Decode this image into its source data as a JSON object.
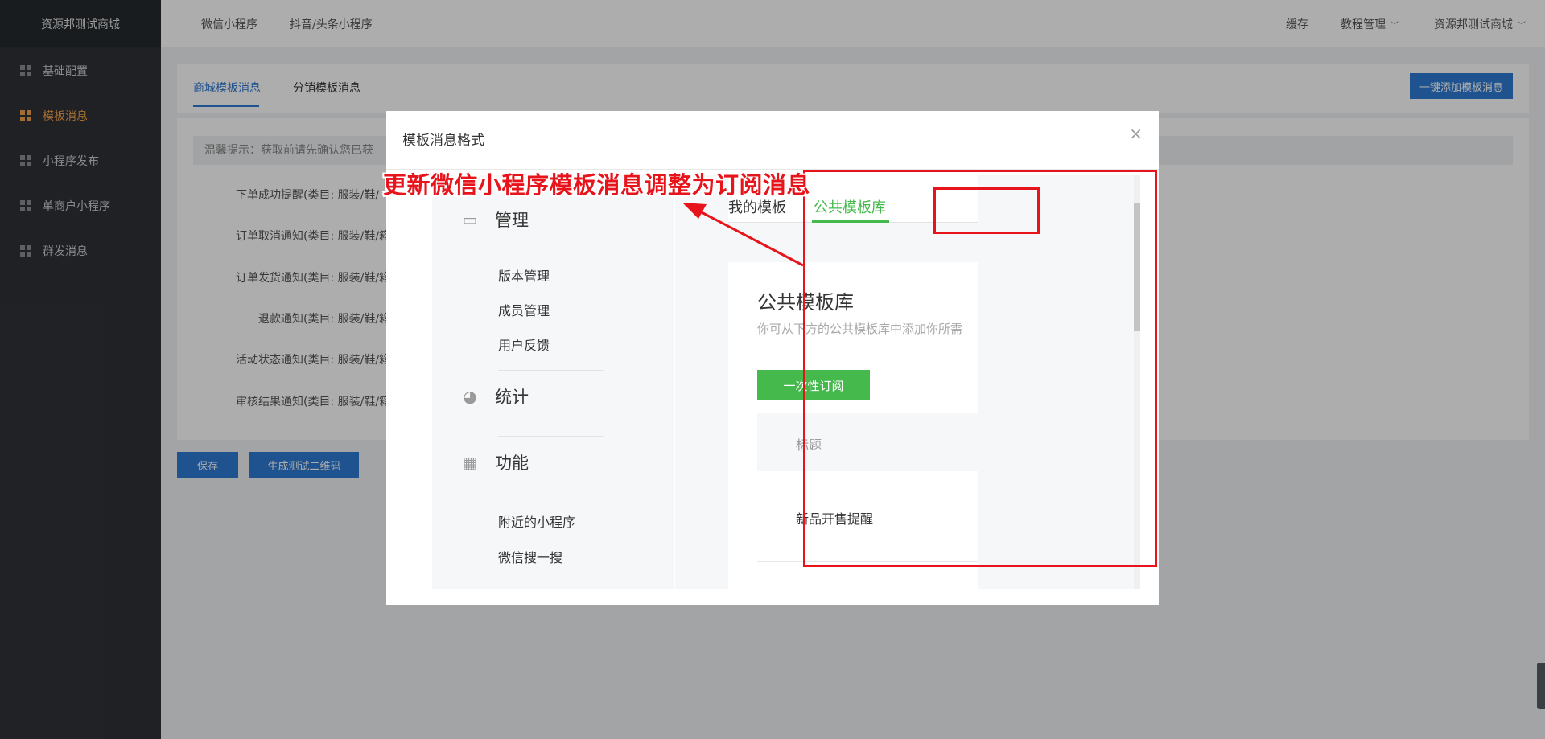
{
  "sidebar": {
    "logo": "资源邦测试商城",
    "items": [
      {
        "label": "基础配置",
        "active": false
      },
      {
        "label": "模板消息",
        "active": true
      },
      {
        "label": "小程序发布",
        "active": false
      },
      {
        "label": "单商户小程序",
        "active": false
      },
      {
        "label": "群发消息",
        "active": false
      }
    ]
  },
  "header": {
    "nav": [
      "微信小程序",
      "抖音/头条小程序"
    ],
    "right": {
      "cache": "缓存",
      "tutorial": "教程管理",
      "store": "资源邦测试商城"
    }
  },
  "tabs": {
    "items": [
      "商城模板消息",
      "分销模板消息"
    ],
    "add_button": "一键添加模板消息"
  },
  "form": {
    "tip": "温馨提示：获取前请先确认您已获",
    "rows": [
      "下单成功提醒(类目: 服装/鞋/",
      "订单取消通知(类目: 服装/鞋/箱",
      "订单发货通知(类目: 服装/鞋/箱",
      "退款通知(类目: 服装/鞋/箱",
      "活动状态通知(类目: 服装/鞋/箱",
      "审核结果通知(类目: 服装/鞋/箱"
    ],
    "save": "保存",
    "qrcode": "生成测试二维码"
  },
  "modal": {
    "title": "模板消息格式",
    "close": "×",
    "screenshot": {
      "menu": {
        "manage": "管理",
        "manage_items": [
          "版本管理",
          "成员管理",
          "用户反馈"
        ],
        "stats": "统计",
        "features": "功能",
        "feature_items": [
          "附近的小程序",
          "微信搜一搜"
        ]
      },
      "tabs": [
        "我的模板",
        "公共模板库"
      ],
      "card": {
        "title": "公共模板库",
        "desc": "你可从下方的公共模板库中添加你所需",
        "button": "一次性订阅",
        "header_label": "标题",
        "item": "新品开售提醒"
      }
    }
  },
  "annotation": {
    "text": "更新微信小程序模板消息调整为订阅消息",
    "color": "#e8141b"
  },
  "colors": {
    "sidebar_bg": "#2f3237",
    "accent_blue": "#2f7bd5",
    "wechat_green": "#45b94c",
    "sidebar_active": "#f0a04b"
  }
}
